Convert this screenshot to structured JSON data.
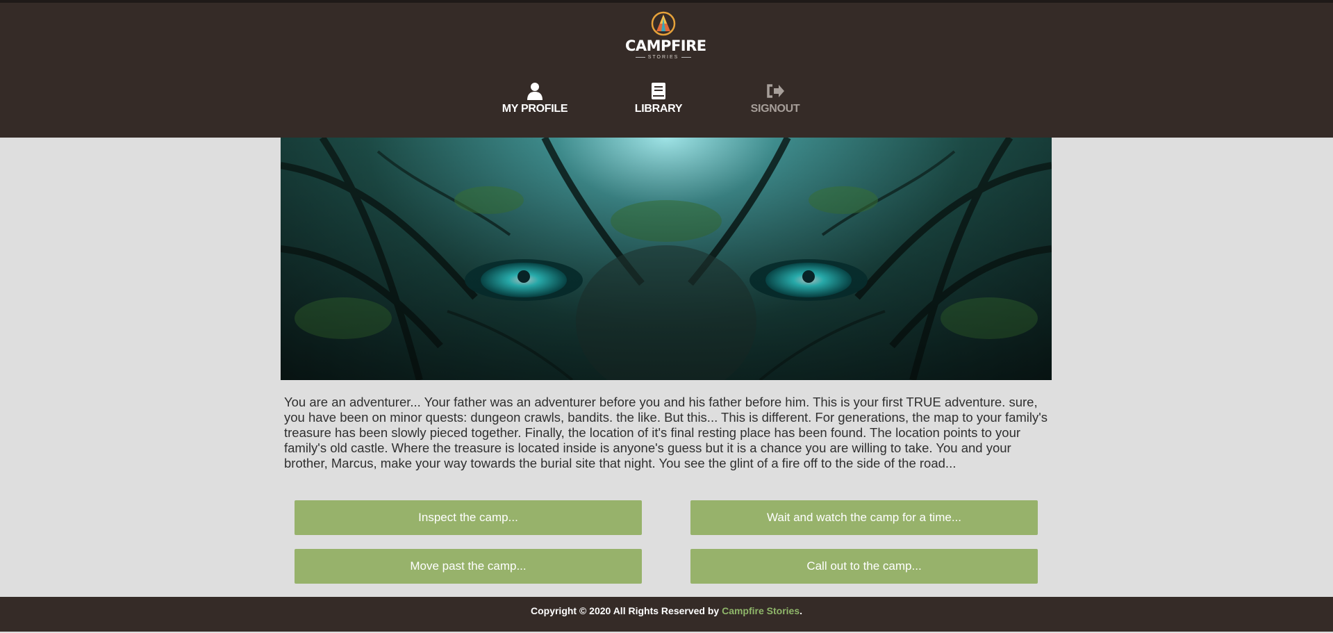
{
  "brand": {
    "name": "CAMPFIRE",
    "tagline": "STORIES"
  },
  "nav": {
    "profile": {
      "label": "MY PROFILE",
      "icon": "user-icon"
    },
    "library": {
      "label": "LIBRARY",
      "icon": "book-icon"
    },
    "signout": {
      "label": "SIGNOUT",
      "icon": "sign-out-icon"
    }
  },
  "story": {
    "text": "You are an adventurer... Your father was an adventurer before you and his father before him. This is your first TRUE adventure. sure, you have been on minor quests: dungeon crawls, bandits. the like. But this... This is different. For generations, the map to your family's treasure has been slowly pieced together. Finally, the location of it's final resting place has been found. The location points to your family's old castle. Where the treasure is located inside is anyone's guess but it is a chance you are willing to take. You and your brother, Marcus, make your way towards the burial site that night. You see the glint of a fire off to the side of the road..."
  },
  "choices": [
    {
      "label": "Inspect the camp..."
    },
    {
      "label": "Wait and watch the camp for a time..."
    },
    {
      "label": "Move past the camp..."
    },
    {
      "label": "Call out to the camp..."
    }
  ],
  "footer": {
    "prefix": "Copyright © 2020 All Rights Reserved by ",
    "link": "Campfire Stories",
    "suffix": "."
  },
  "colors": {
    "header_bg": "#352b27",
    "page_bg": "#dedede",
    "button_bg": "#97b26b",
    "footer_link": "#8fb66a",
    "signout_text": "#a79f9a"
  }
}
